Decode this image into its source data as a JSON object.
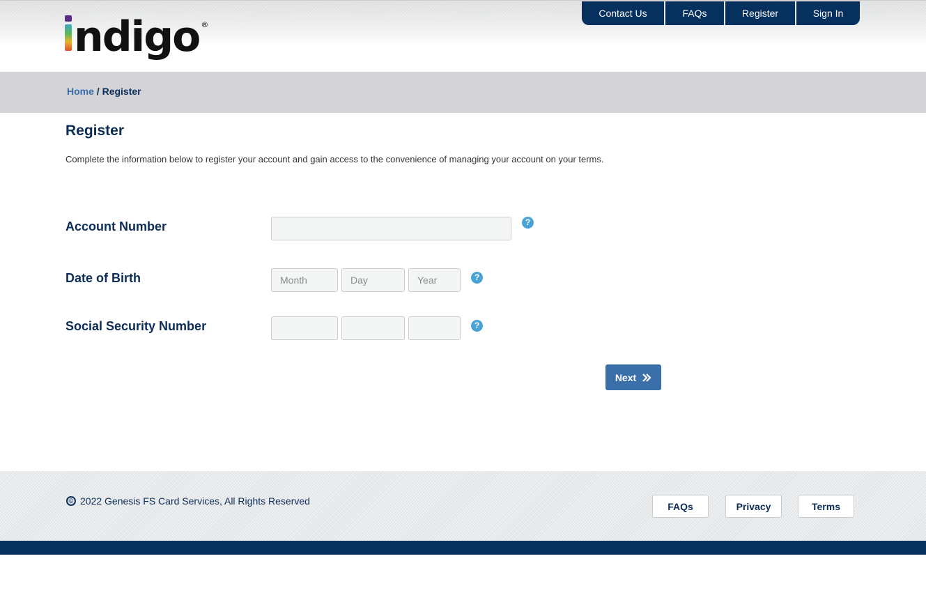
{
  "brand": {
    "logo_text": "ndigo",
    "logo_full": "indigo",
    "registered_mark": "®",
    "colors": {
      "navy": "#06305e",
      "link_blue": "#3c6fa8",
      "help_blue": "#4aa3d6",
      "button_blue": "#3a6faa"
    }
  },
  "topnav": {
    "items": [
      {
        "label": "Contact Us"
      },
      {
        "label": "FAQs"
      },
      {
        "label": "Register"
      },
      {
        "label": "Sign In"
      }
    ]
  },
  "breadcrumb": {
    "home": "Home",
    "separator": " / ",
    "current": "Register"
  },
  "main": {
    "title": "Register",
    "intro": "Complete the information below to register your account and gain access to the convenience of managing your account on your terms.",
    "fields": {
      "account_number": {
        "label": "Account Number",
        "value": "",
        "placeholder": "",
        "help_icon": "question-circle-icon"
      },
      "date_of_birth": {
        "label": "Date of Birth",
        "month": {
          "value": "",
          "placeholder": "Month"
        },
        "day": {
          "value": "",
          "placeholder": "Day"
        },
        "year": {
          "value": "",
          "placeholder": "Year"
        },
        "help_icon": "question-circle-icon"
      },
      "ssn": {
        "label": "Social Security Number",
        "part1": {
          "value": "",
          "placeholder": ""
        },
        "part2": {
          "value": "",
          "placeholder": ""
        },
        "part3": {
          "value": "",
          "placeholder": ""
        },
        "help_icon": "question-circle-icon"
      }
    },
    "help_glyph": "?",
    "next_button": {
      "label": "Next",
      "icon": "double-chevron-right-icon"
    }
  },
  "footer": {
    "copyright_glyph": "©",
    "copyright": "2022  Genesis FS Card Services, All Rights Reserved",
    "links": [
      {
        "label": "FAQs"
      },
      {
        "label": "Privacy"
      },
      {
        "label": "Terms"
      }
    ]
  }
}
